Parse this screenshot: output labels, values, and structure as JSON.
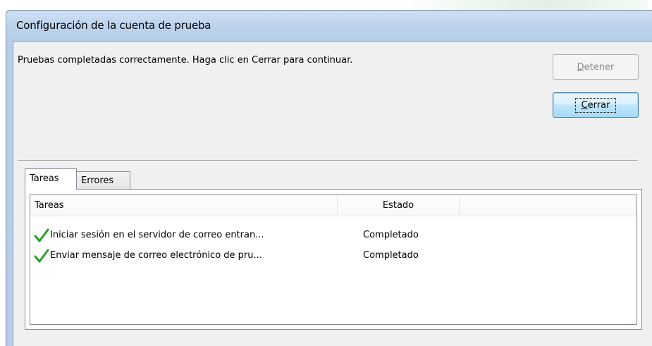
{
  "window": {
    "title": "Configuración de la cuenta de prueba"
  },
  "message": "Pruebas completadas correctamente. Haga clic en Cerrar para continuar.",
  "buttons": {
    "stop": {
      "mnemonic": "D",
      "rest": "etener",
      "enabled": false
    },
    "close": {
      "mnemonic": "C",
      "rest": "errar",
      "enabled": true
    }
  },
  "tabs": [
    {
      "label": "Tareas",
      "selected": true
    },
    {
      "label": "Errores",
      "selected": false
    }
  ],
  "list": {
    "columns": [
      "Tareas",
      "Estado",
      ""
    ],
    "rows": [
      {
        "icon": "checkmark-icon",
        "task": "Iniciar sesión en el servidor de correo entran...",
        "status": "Completado"
      },
      {
        "icon": "checkmark-icon",
        "task": "Enviar mensaje de correo electrónico de pru...",
        "status": "Completado"
      }
    ]
  },
  "colors": {
    "check_green": "#2e9e2a",
    "titlebar": "#bcd2eb",
    "client": "#f0f0f0"
  }
}
